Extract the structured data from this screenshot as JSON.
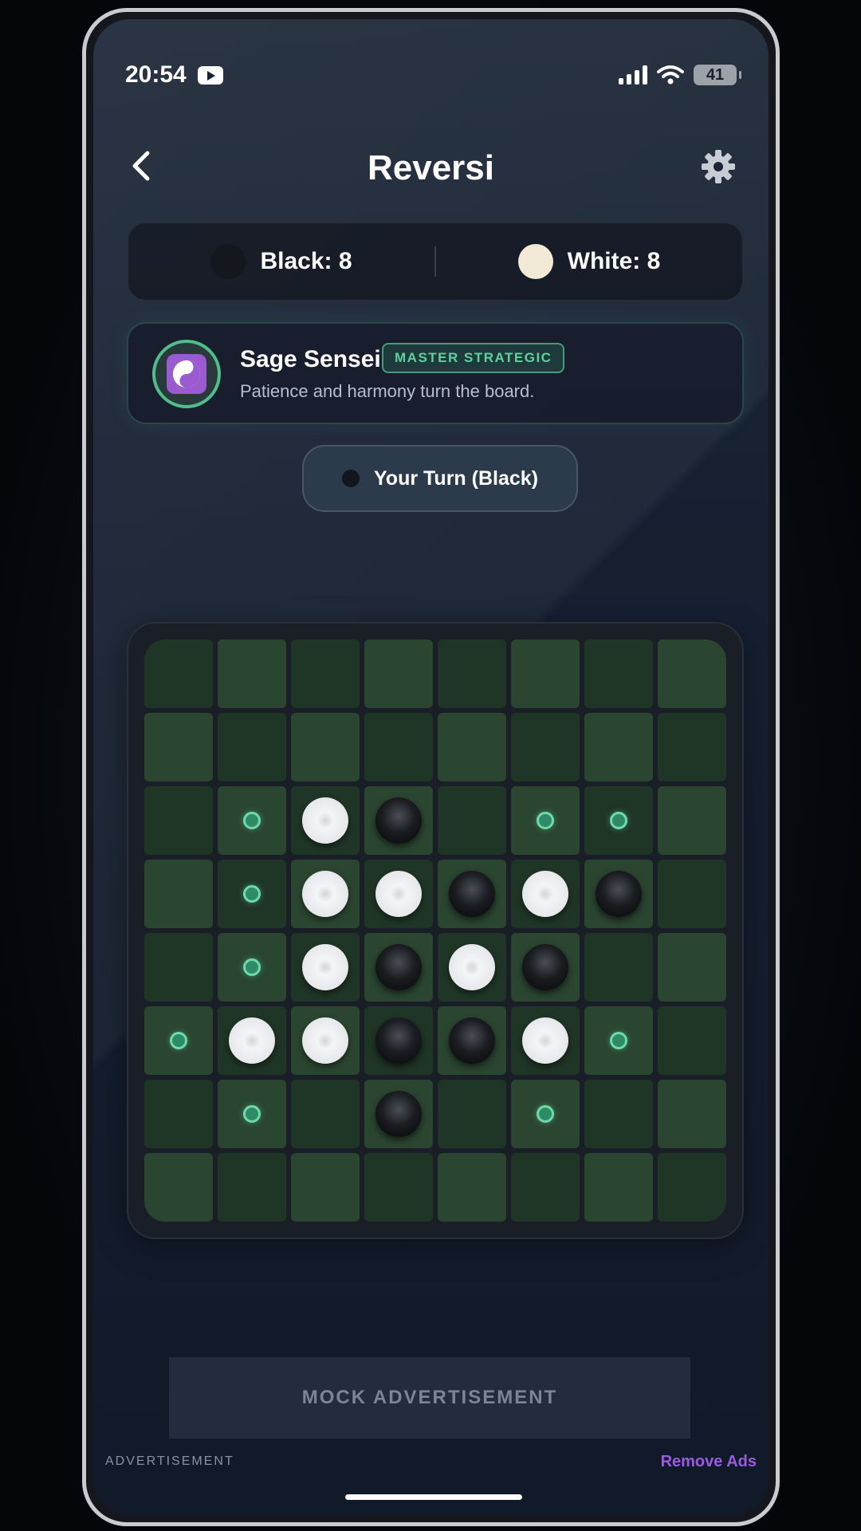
{
  "status_bar": {
    "time": "20:54",
    "battery": "41"
  },
  "header": {
    "title": "Reversi"
  },
  "score": {
    "black_label": "Black: 8",
    "white_label": "White: 8"
  },
  "opponent": {
    "name": "Sage Sensei",
    "badge": "MASTER STRATEGIC",
    "quote": "Patience and harmony turn the board.",
    "avatar_icon": "yin-yang-icon"
  },
  "turn": {
    "label": "Your Turn (Black)"
  },
  "board": {
    "rows": [
      "........",
      "........",
      ".*WB.**.",
      ".*WWBWB.",
      ".*WBWB..",
      "*WWBBW*.",
      ".*.B.*..",
      "........"
    ],
    "legend": {
      "B": "black",
      "W": "white",
      "*": "valid-move",
      ".": "empty"
    }
  },
  "ad": {
    "banner": "MOCK ADVERTISEMENT",
    "label": "ADVERTISEMENT",
    "remove": "Remove Ads"
  },
  "colors": {
    "accent_green": "#4fbf8a",
    "remove_ads": "#9b5be0",
    "board_light": "#2a4530",
    "board_dark": "#1f3525"
  }
}
